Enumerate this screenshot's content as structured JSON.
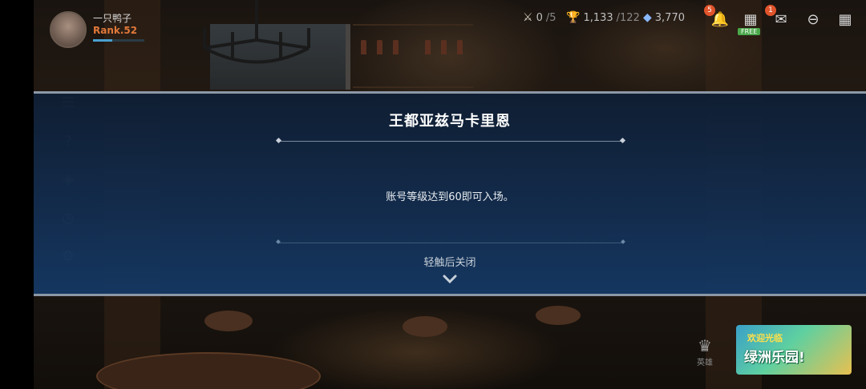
{
  "player": {
    "name": "一只鸭子",
    "rank": "Rank.52",
    "exp_progress": 0.38
  },
  "resources": [
    {
      "icon": "crossed-swords-icon",
      "value": "0",
      "sub": "/5"
    },
    {
      "icon": "trophy-icon",
      "value": "1,133",
      "sub": "/122"
    },
    {
      "icon": "crystal-icon",
      "value": "3,770",
      "sub": ""
    }
  ],
  "top_icons": {
    "bell_badge": "5",
    "shop_tag": "FREE",
    "mail_badge": "1"
  },
  "dialog": {
    "title": "王都亚兹马卡里恩",
    "message": "账号等级达到60即可入场。",
    "close_hint": "轻触后关闭"
  },
  "bottom": {
    "hero_label": "英雄",
    "promo_top": "欢迎光临",
    "promo_main": "绿洲乐园!"
  },
  "colors": {
    "dialog_top": "#0e1e34",
    "dialog_bottom": "#143864",
    "rank": "#e0783a",
    "badge": "#e0542c"
  }
}
